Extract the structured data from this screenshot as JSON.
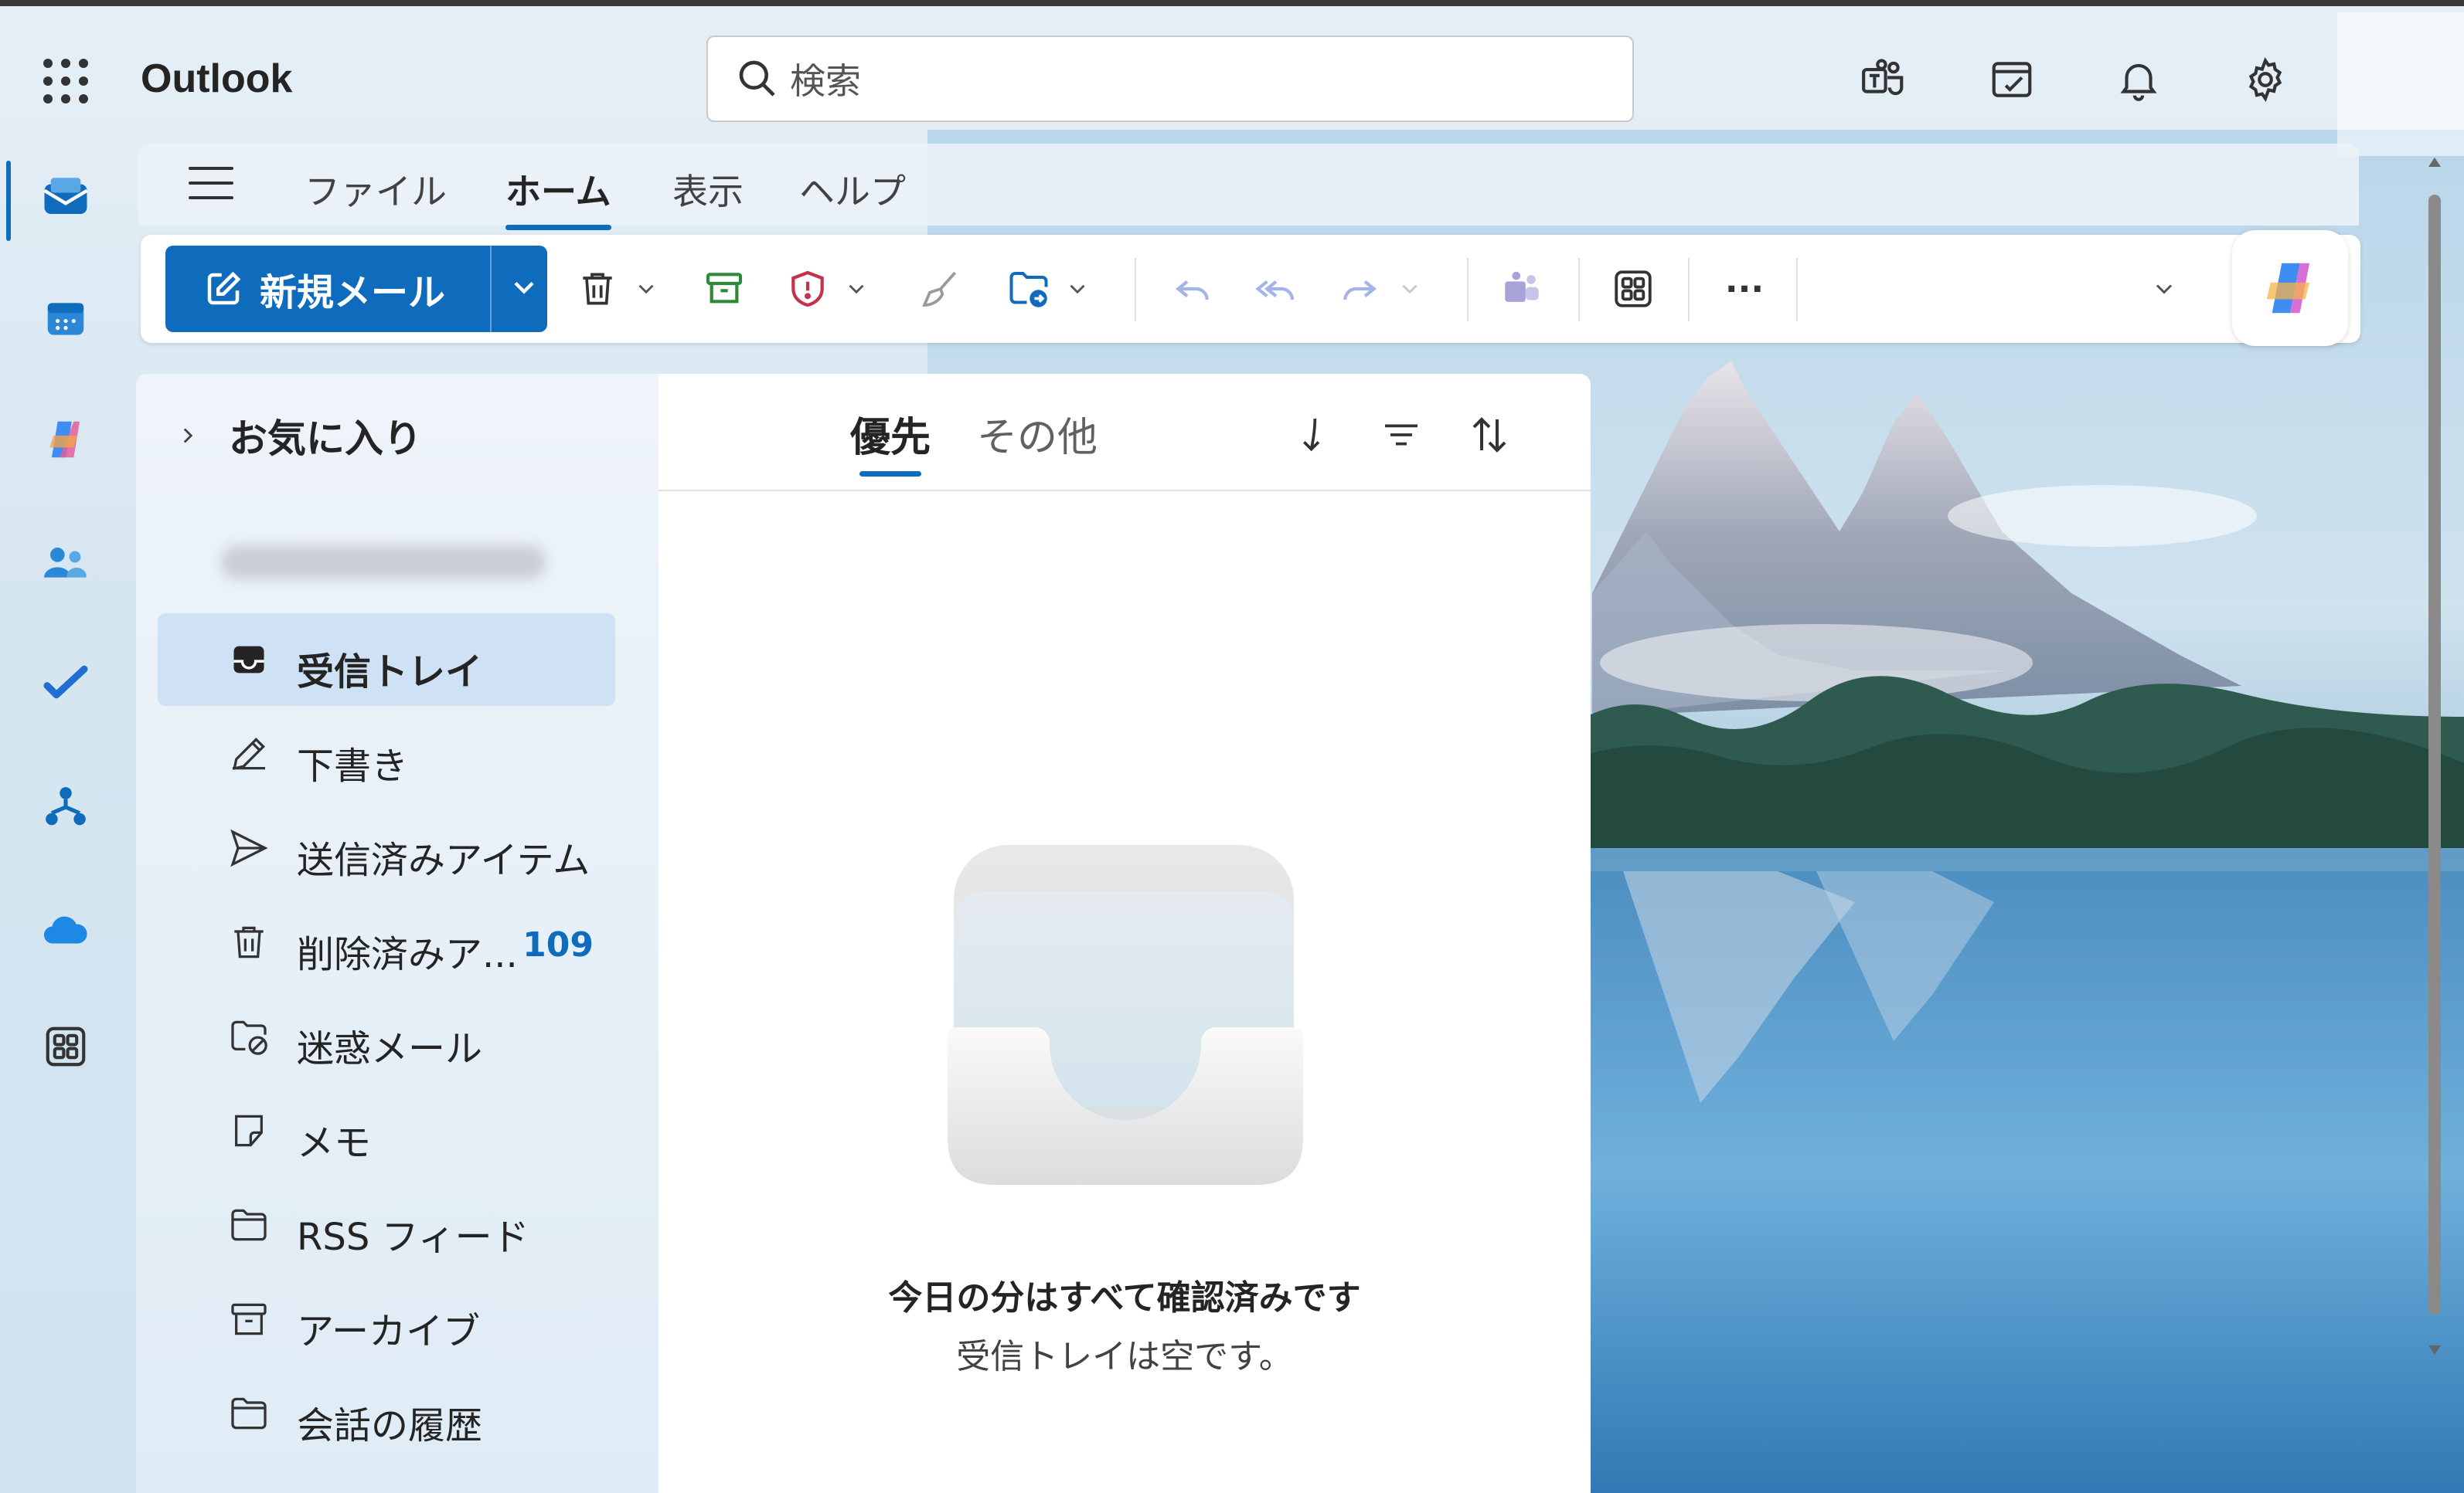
{
  "app": {
    "title": "Outlook"
  },
  "search": {
    "placeholder": "検索"
  },
  "topbar_icons": [
    "teams-icon",
    "todo-note-icon",
    "bell-icon",
    "gear-icon"
  ],
  "rail": [
    "mail-icon",
    "calendar-icon",
    "copilot-icon",
    "people-icon",
    "todo-check-icon",
    "org-icon",
    "onedrive-icon",
    "more-apps-icon"
  ],
  "tabs": {
    "file": "ファイル",
    "home": "ホーム",
    "view": "表示",
    "help": "ヘルプ"
  },
  "ribbon": {
    "new_mail": "新規メール",
    "more": "···"
  },
  "folders": {
    "favorites": "お気に入り",
    "items": [
      {
        "label": "受信トレイ",
        "icon": "inbox-icon",
        "count": ""
      },
      {
        "label": "下書き",
        "icon": "draft-icon",
        "count": ""
      },
      {
        "label": "送信済みアイテム",
        "icon": "send-icon",
        "count": ""
      },
      {
        "label": "削除済みア...",
        "icon": "trash-icon",
        "count": "109"
      },
      {
        "label": "迷惑メール",
        "icon": "junk-icon",
        "count": ""
      },
      {
        "label": "メモ",
        "icon": "note-icon",
        "count": ""
      },
      {
        "label": "RSS フィード",
        "icon": "folder-icon",
        "count": ""
      },
      {
        "label": "アーカイブ",
        "icon": "archive-icon",
        "count": ""
      },
      {
        "label": "会話の履歴",
        "icon": "folder-icon",
        "count": ""
      }
    ]
  },
  "message_list": {
    "tab_focused": "優先",
    "tab_other": "その他",
    "empty_title": "今日の分はすべて確認済みです",
    "empty_subtitle": "受信トレイは空です。"
  },
  "colors": {
    "accent": "#0f6cbd",
    "selected_bg": "#cfe2f5"
  }
}
